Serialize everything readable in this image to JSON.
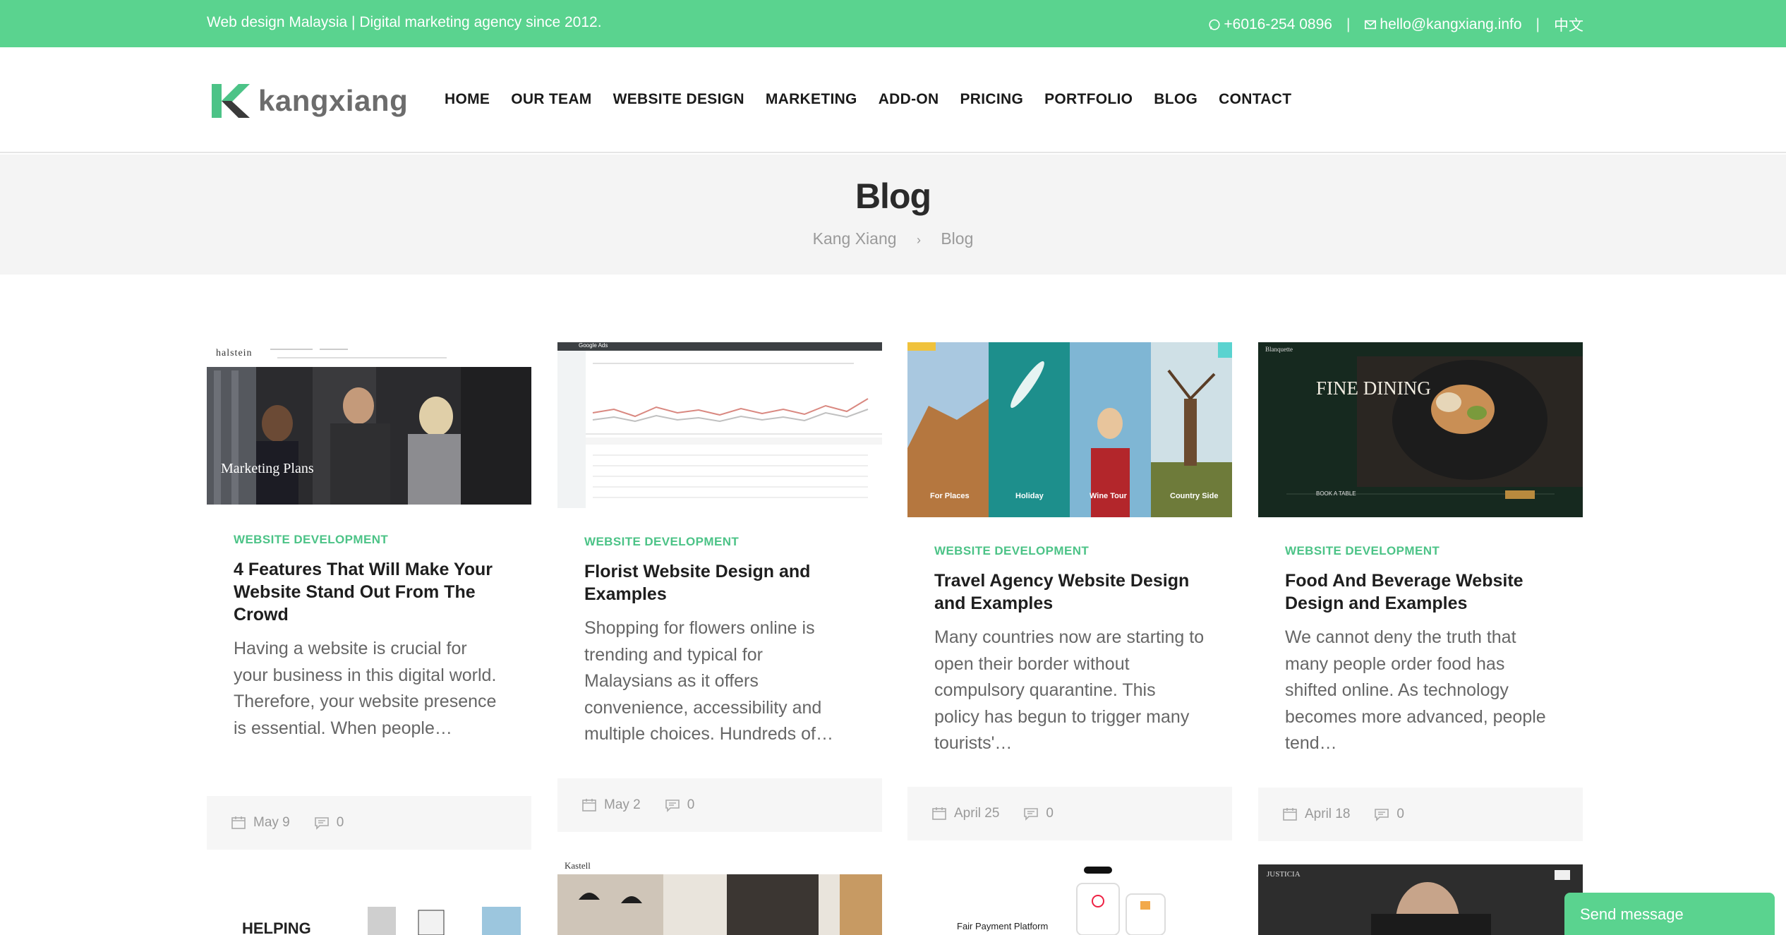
{
  "topbar": {
    "tagline": "Web design Malaysia | Digital marketing agency since 2012.",
    "phone": "+6016-254 0896",
    "email": "hello@kangxiang.info",
    "language": "中文",
    "bg_color": "#5ad38f"
  },
  "header": {
    "logo_text": "kangxiang",
    "nav": [
      "HOME",
      "OUR TEAM",
      "WEBSITE DESIGN",
      "MARKETING",
      "ADD-ON",
      "PRICING",
      "PORTFOLIO",
      "BLOG",
      "CONTACT"
    ]
  },
  "page": {
    "title": "Blog",
    "breadcrumb": [
      "Kang Xiang",
      "Blog"
    ]
  },
  "posts": [
    {
      "category": "WEBSITE DEVELOPMENT",
      "title": "4 Features That Will Make Your Website Stand Out From The Crowd",
      "excerpt": "Having a website is crucial for your business in this digital world. Therefore, your website presence is essential. When people…",
      "date": "May 9",
      "comments": "0",
      "thumb_brand": "halstein",
      "thumb_caption": "Marketing Plans"
    },
    {
      "category": "WEBSITE DEVELOPMENT",
      "title": "Florist Website Design and Examples",
      "excerpt": "Shopping for flowers online is trending and typical for Malaysians as it offers convenience, accessibility and multiple choices. Hundreds of…",
      "date": "May 2",
      "comments": "0",
      "thumb_brand": "Google Ads"
    },
    {
      "category": "WEBSITE DEVELOPMENT",
      "title": "Travel Agency Website Design and Examples",
      "excerpt": "Many countries now are starting to open their border without compulsory quarantine. This policy has begun to trigger many tourists'…",
      "date": "April 25",
      "comments": "0",
      "thumb_panels": [
        "For Places",
        "Holiday",
        "Wine Tour",
        "Country Side"
      ]
    },
    {
      "category": "WEBSITE DEVELOPMENT",
      "title": "Food And Beverage Website Design and Examples",
      "excerpt": "We cannot deny the truth that many people order food has shifted online. As technology becomes more advanced, people tend…",
      "date": "April 18",
      "comments": "0",
      "thumb_brand": "Blanquette",
      "thumb_caption": "FINE DINING",
      "thumb_button": "BOOK A TABLE"
    }
  ],
  "second_row": {
    "post5_heading": "HELPING",
    "post6_brand": "Kastell",
    "post7_caption": "Fair Payment Platform",
    "post8_brand": "JUSTICIA"
  },
  "chat": {
    "label": "Send message"
  }
}
